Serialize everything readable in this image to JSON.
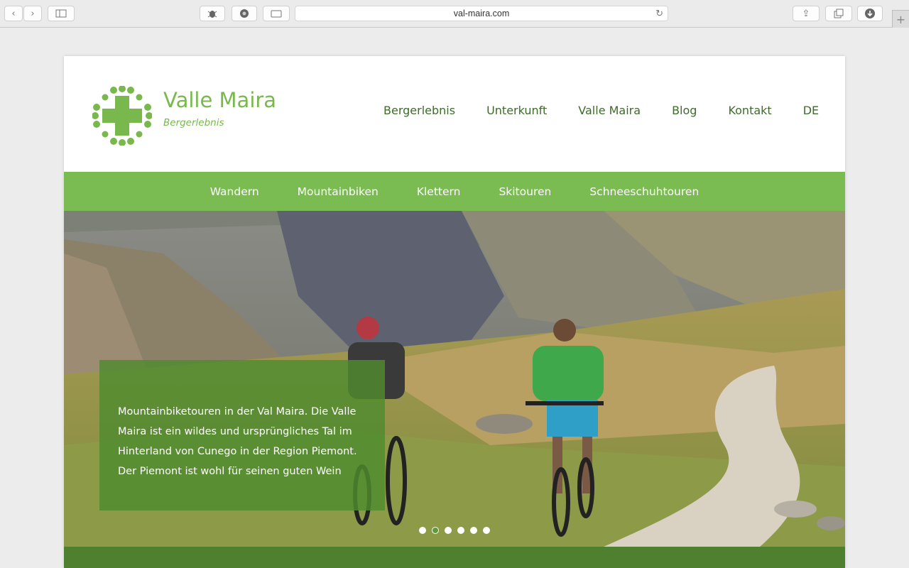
{
  "browser": {
    "url": "val-maira.com",
    "icons": [
      "back-arrow-icon",
      "forward-arrow-icon",
      "sidebar-icon",
      "bug-icon",
      "eye-icon",
      "keyboard-icon",
      "reload-icon",
      "share-icon",
      "tabs-icon",
      "download-icon",
      "plus-icon"
    ]
  },
  "header": {
    "title": "Valle Maira",
    "subtitle": "Bergerlebnis",
    "nav": [
      "Bergerlebnis",
      "Unterkunft",
      "Valle Maira",
      "Blog",
      "Kontakt",
      "DE"
    ]
  },
  "subnav": [
    "Wandern",
    "Mountainbiken",
    "Klettern",
    "Skitouren",
    "Schneeschuhtouren"
  ],
  "hero": {
    "caption": "Mountainbiketouren in der Val Maira. Die Valle Maira ist ein wildes und ursprüngliches Tal im Hinterland von Cunego in der Region Piemont. Der Piemont ist wohl für seinen guten Wein",
    "slides_total": 6,
    "active_slide": 2
  },
  "colors": {
    "brand_green": "#79b84c",
    "nav_green": "#3e6b2b",
    "bar_green": "#7bbc52",
    "dark_green": "#4e8030"
  }
}
